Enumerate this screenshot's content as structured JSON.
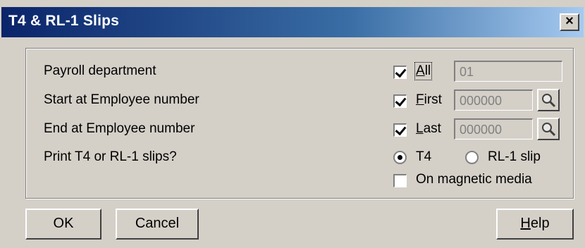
{
  "window": {
    "title": "T4 & RL-1 Slips",
    "close_label": "×"
  },
  "form": {
    "payroll_department_label": "Payroll department",
    "start_employee_label": "Start at Employee number",
    "end_employee_label": "End at Employee number",
    "print_slips_label": "Print T4 or RL-1 slips?",
    "all": {
      "mnemonic": "A",
      "rest": "ll",
      "checked": true
    },
    "first": {
      "mnemonic": "F",
      "rest": "irst",
      "checked": true
    },
    "last": {
      "mnemonic": "L",
      "rest": "ast",
      "checked": true
    },
    "department_value": "01",
    "start_value": "000000",
    "end_value": "000000",
    "t4_label": "T4",
    "rl1_label": "RL-1 slip",
    "selected_slip": "T4",
    "magnetic_media_label": "On magnetic media",
    "magnetic_media_checked": false
  },
  "buttons": {
    "ok": "OK",
    "cancel": "Cancel",
    "help_mnemonic": "H",
    "help_rest": "elp"
  },
  "icons": {
    "lookup": "magnifier-icon",
    "close": "close-icon"
  }
}
